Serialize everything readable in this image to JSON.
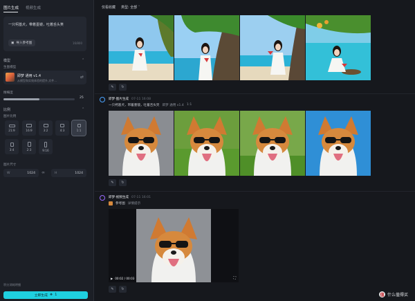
{
  "left_panel": {
    "tabs": [
      "图片生成",
      "视频生成"
    ],
    "prompt": {
      "text": "一只柯基犬，带着墨镜，吐着舌头笑",
      "ref_button": "导入参考图",
      "char_count": "16/800"
    },
    "model_section": {
      "title": "模型",
      "sub_label": "生图模型",
      "model_name": "即梦 通用 v1.4",
      "model_desc": "从模型和实效体验的提升,文件..."
    },
    "quality": {
      "label": "精细度",
      "value": "25",
      "level": 0.5
    },
    "ratio_section": {
      "title": "比例",
      "sub_label": "图片比例",
      "ratios": [
        "21:9",
        "16:9",
        "3:2",
        "4:3",
        "1:1",
        "3:4",
        "2:3",
        "9:16"
      ],
      "selected": "1:1"
    },
    "size_section": {
      "label": "图片尺寸",
      "width_label": "W",
      "width": "1024",
      "height_label": "H",
      "height": "1024"
    },
    "footer_note": "积分消耗明细",
    "generate_button": "立即生成",
    "generate_cost": "1"
  },
  "right_panel": {
    "filters": [
      {
        "label": "仅看收藏"
      },
      {
        "label": "类型: 全部"
      }
    ],
    "groups": [
      {
        "title": "即梦·图片生成",
        "time": "07-11 16:08",
        "prompt": "一只柯基犬，带着墨镜，吐着舌头笑",
        "model": "即梦 通用 v1.4",
        "ratio": "1:1"
      },
      {
        "title": "即梦·视频生成",
        "time": "07-11 16:01",
        "prompt_ref": "参考图",
        "prompt_extra": "详情提示",
        "video_time": "00:02 / 00:03"
      }
    ]
  },
  "watermark": {
    "logo": "值",
    "text": "什么值得买"
  }
}
